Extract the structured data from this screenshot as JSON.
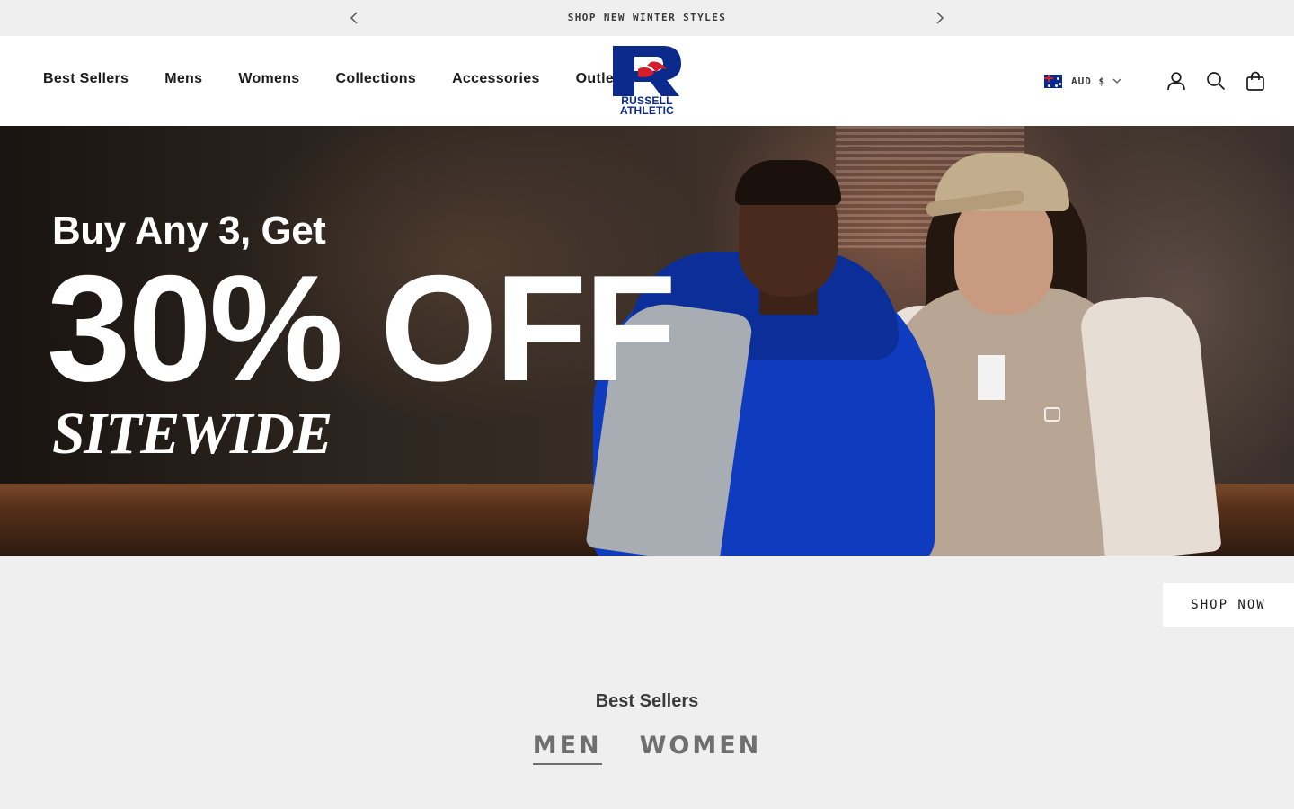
{
  "announcement": {
    "text": "SHOP NEW WINTER STYLES"
  },
  "nav": {
    "items": [
      "Best Sellers",
      "Mens",
      "Womens",
      "Collections",
      "Accessories",
      "Outlet"
    ]
  },
  "logo": {
    "line1": "RUSSELL",
    "line2": "ATHLETIC",
    "brand_blue": "#0b2a8c",
    "brand_red": "#d41f2b"
  },
  "header_tools": {
    "currency": "AUD $",
    "flag": "australia-flag-icon",
    "icons": [
      "account-icon",
      "search-icon",
      "cart-icon"
    ]
  },
  "hero": {
    "line1": "Buy Any 3, Get",
    "line2": "30% OFF",
    "line3": "SITEWIDE"
  },
  "cta": {
    "shop_now": "SHOP NOW"
  },
  "best_sellers": {
    "title": "Best Sellers",
    "tabs": [
      "MEN",
      "WOMEN"
    ],
    "active_tab": "MEN"
  }
}
